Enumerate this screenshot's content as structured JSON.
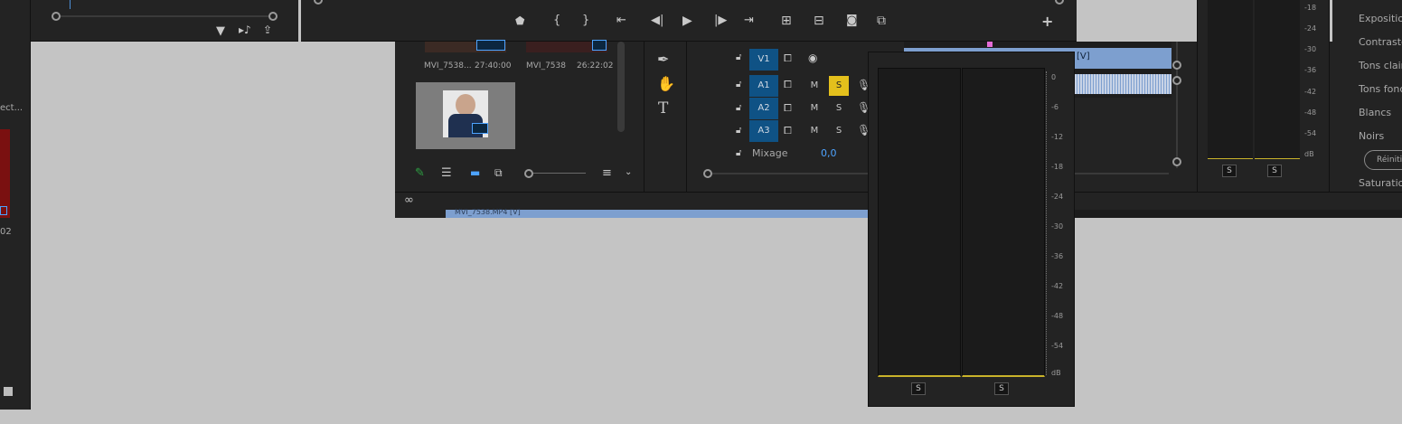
{
  "left_panel": {
    "label_fragment": "ect...",
    "number_fragment": "02"
  },
  "project": {
    "items": [
      {
        "name": "MVI_7538...",
        "duration": "27:40:00"
      },
      {
        "name": "MVI_7538",
        "duration": "26:22:02"
      }
    ],
    "clip_strip_label": "MVI_7538.MP4 [V]"
  },
  "timeline": {
    "tracks": [
      {
        "name": "V1"
      },
      {
        "name": "A1",
        "mute": "M",
        "solo": "S"
      },
      {
        "name": "A2",
        "mute": "M",
        "solo": "S"
      },
      {
        "name": "A3",
        "mute": "M",
        "solo": "S"
      }
    ],
    "mix_label": "Mixage",
    "mix_value": "0,0",
    "clip_label": "[V]"
  },
  "meter_small": {
    "scale": [
      "-18",
      "-24",
      "-30",
      "-36",
      "-42",
      "-48",
      "-54",
      "dB"
    ],
    "solo_buttons": [
      "S",
      "S"
    ]
  },
  "meter_popup": {
    "scale": [
      "0",
      "-6",
      "-12",
      "-18",
      "-24",
      "-30",
      "-36",
      "-42",
      "-48",
      "-54",
      "dB"
    ],
    "solo_buttons": [
      "S",
      "S"
    ]
  },
  "lumetri": {
    "items": [
      "Exposition",
      "Contraste",
      "Tons clairs",
      "Tons foncés",
      "Blancs",
      "Noirs"
    ],
    "reset_label": "Réinitialiser",
    "saturation_label": "Saturation"
  },
  "colors": {
    "accent_blue": "#0f5285",
    "solo_yellow": "#e4c01c",
    "clip_blue": "#7d9fcf",
    "cc_green": "#2ea043"
  }
}
